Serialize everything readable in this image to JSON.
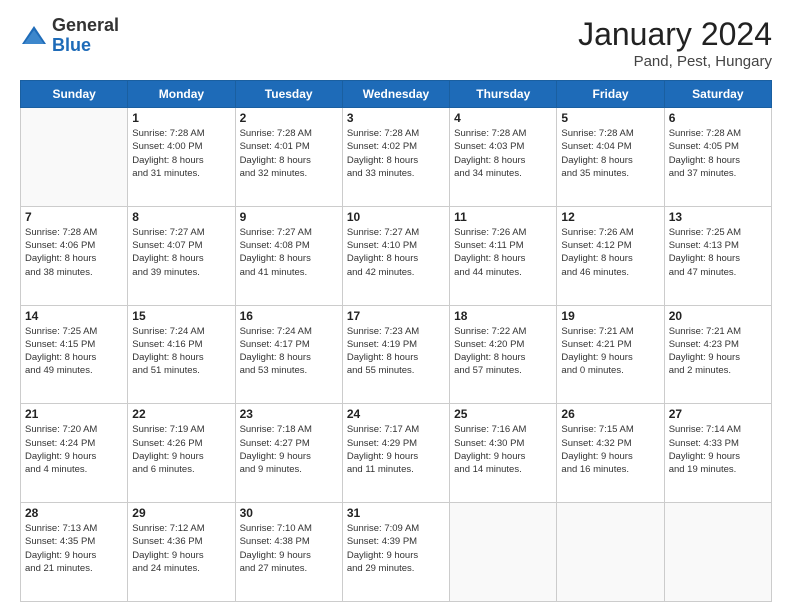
{
  "header": {
    "logo_general": "General",
    "logo_blue": "Blue",
    "title": "January 2024",
    "location": "Pand, Pest, Hungary"
  },
  "days_of_week": [
    "Sunday",
    "Monday",
    "Tuesday",
    "Wednesday",
    "Thursday",
    "Friday",
    "Saturday"
  ],
  "weeks": [
    [
      {
        "day": "",
        "info": ""
      },
      {
        "day": "1",
        "info": "Sunrise: 7:28 AM\nSunset: 4:00 PM\nDaylight: 8 hours\nand 31 minutes."
      },
      {
        "day": "2",
        "info": "Sunrise: 7:28 AM\nSunset: 4:01 PM\nDaylight: 8 hours\nand 32 minutes."
      },
      {
        "day": "3",
        "info": "Sunrise: 7:28 AM\nSunset: 4:02 PM\nDaylight: 8 hours\nand 33 minutes."
      },
      {
        "day": "4",
        "info": "Sunrise: 7:28 AM\nSunset: 4:03 PM\nDaylight: 8 hours\nand 34 minutes."
      },
      {
        "day": "5",
        "info": "Sunrise: 7:28 AM\nSunset: 4:04 PM\nDaylight: 8 hours\nand 35 minutes."
      },
      {
        "day": "6",
        "info": "Sunrise: 7:28 AM\nSunset: 4:05 PM\nDaylight: 8 hours\nand 37 minutes."
      }
    ],
    [
      {
        "day": "7",
        "info": "Sunrise: 7:28 AM\nSunset: 4:06 PM\nDaylight: 8 hours\nand 38 minutes."
      },
      {
        "day": "8",
        "info": "Sunrise: 7:27 AM\nSunset: 4:07 PM\nDaylight: 8 hours\nand 39 minutes."
      },
      {
        "day": "9",
        "info": "Sunrise: 7:27 AM\nSunset: 4:08 PM\nDaylight: 8 hours\nand 41 minutes."
      },
      {
        "day": "10",
        "info": "Sunrise: 7:27 AM\nSunset: 4:10 PM\nDaylight: 8 hours\nand 42 minutes."
      },
      {
        "day": "11",
        "info": "Sunrise: 7:26 AM\nSunset: 4:11 PM\nDaylight: 8 hours\nand 44 minutes."
      },
      {
        "day": "12",
        "info": "Sunrise: 7:26 AM\nSunset: 4:12 PM\nDaylight: 8 hours\nand 46 minutes."
      },
      {
        "day": "13",
        "info": "Sunrise: 7:25 AM\nSunset: 4:13 PM\nDaylight: 8 hours\nand 47 minutes."
      }
    ],
    [
      {
        "day": "14",
        "info": "Sunrise: 7:25 AM\nSunset: 4:15 PM\nDaylight: 8 hours\nand 49 minutes."
      },
      {
        "day": "15",
        "info": "Sunrise: 7:24 AM\nSunset: 4:16 PM\nDaylight: 8 hours\nand 51 minutes."
      },
      {
        "day": "16",
        "info": "Sunrise: 7:24 AM\nSunset: 4:17 PM\nDaylight: 8 hours\nand 53 minutes."
      },
      {
        "day": "17",
        "info": "Sunrise: 7:23 AM\nSunset: 4:19 PM\nDaylight: 8 hours\nand 55 minutes."
      },
      {
        "day": "18",
        "info": "Sunrise: 7:22 AM\nSunset: 4:20 PM\nDaylight: 8 hours\nand 57 minutes."
      },
      {
        "day": "19",
        "info": "Sunrise: 7:21 AM\nSunset: 4:21 PM\nDaylight: 9 hours\nand 0 minutes."
      },
      {
        "day": "20",
        "info": "Sunrise: 7:21 AM\nSunset: 4:23 PM\nDaylight: 9 hours\nand 2 minutes."
      }
    ],
    [
      {
        "day": "21",
        "info": "Sunrise: 7:20 AM\nSunset: 4:24 PM\nDaylight: 9 hours\nand 4 minutes."
      },
      {
        "day": "22",
        "info": "Sunrise: 7:19 AM\nSunset: 4:26 PM\nDaylight: 9 hours\nand 6 minutes."
      },
      {
        "day": "23",
        "info": "Sunrise: 7:18 AM\nSunset: 4:27 PM\nDaylight: 9 hours\nand 9 minutes."
      },
      {
        "day": "24",
        "info": "Sunrise: 7:17 AM\nSunset: 4:29 PM\nDaylight: 9 hours\nand 11 minutes."
      },
      {
        "day": "25",
        "info": "Sunrise: 7:16 AM\nSunset: 4:30 PM\nDaylight: 9 hours\nand 14 minutes."
      },
      {
        "day": "26",
        "info": "Sunrise: 7:15 AM\nSunset: 4:32 PM\nDaylight: 9 hours\nand 16 minutes."
      },
      {
        "day": "27",
        "info": "Sunrise: 7:14 AM\nSunset: 4:33 PM\nDaylight: 9 hours\nand 19 minutes."
      }
    ],
    [
      {
        "day": "28",
        "info": "Sunrise: 7:13 AM\nSunset: 4:35 PM\nDaylight: 9 hours\nand 21 minutes."
      },
      {
        "day": "29",
        "info": "Sunrise: 7:12 AM\nSunset: 4:36 PM\nDaylight: 9 hours\nand 24 minutes."
      },
      {
        "day": "30",
        "info": "Sunrise: 7:10 AM\nSunset: 4:38 PM\nDaylight: 9 hours\nand 27 minutes."
      },
      {
        "day": "31",
        "info": "Sunrise: 7:09 AM\nSunset: 4:39 PM\nDaylight: 9 hours\nand 29 minutes."
      },
      {
        "day": "",
        "info": ""
      },
      {
        "day": "",
        "info": ""
      },
      {
        "day": "",
        "info": ""
      }
    ]
  ]
}
